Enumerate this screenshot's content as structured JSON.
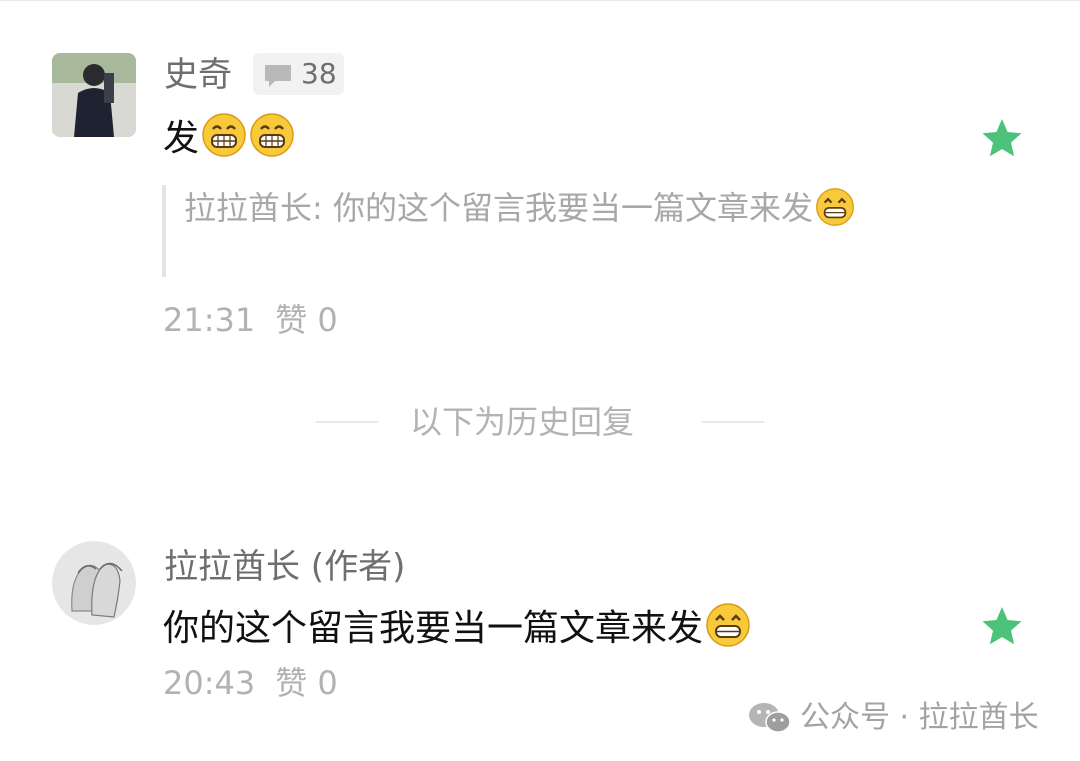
{
  "comment1": {
    "author": "史奇",
    "comment_count": "38",
    "text": "发",
    "quote": {
      "prefix": "拉拉酋长: ",
      "text": "你的这个留言我要当一篇文章来发"
    },
    "time": "21:31",
    "likes": "赞 0"
  },
  "divider": {
    "label": "以下为历史回复"
  },
  "comment2": {
    "author": "拉拉酋长 (作者)",
    "text": "你的这个留言我要当一篇文章来发",
    "time": "20:43",
    "likes": "赞 0"
  },
  "watermark": {
    "text": "公众号 · 拉拉酋长"
  },
  "colors": {
    "star": "#4cc27a",
    "meta": "#b2b2b2",
    "quote": "#a8a8a8"
  },
  "icons": [
    "comment-bubble-icon",
    "grin-emoji-icon",
    "star-icon",
    "wechat-icon"
  ]
}
